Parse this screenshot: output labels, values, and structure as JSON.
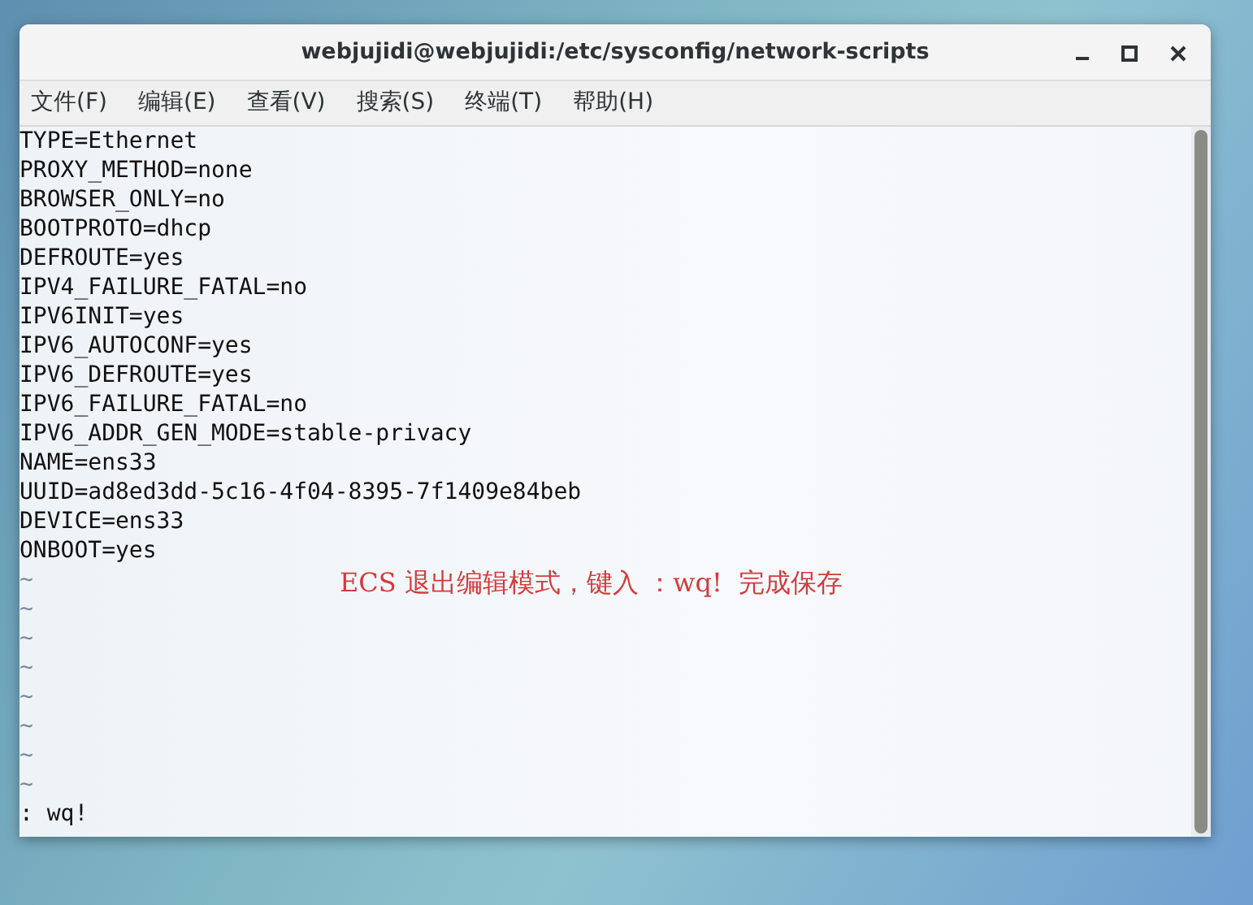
{
  "window": {
    "title": "webjujidi@webjujidi:/etc/sysconfig/network-scripts"
  },
  "menu": [
    "文件(F)",
    "编辑(E)",
    "查看(V)",
    "搜索(S)",
    "终端(T)",
    "帮助(H)"
  ],
  "lines": [
    "TYPE=Ethernet",
    "PROXY_METHOD=none",
    "BROWSER_ONLY=no",
    "BOOTPROTO=dhcp",
    "DEFROUTE=yes",
    "IPV4_FAILURE_FATAL=no",
    "IPV6INIT=yes",
    "IPV6_AUTOCONF=yes",
    "IPV6_DEFROUTE=yes",
    "IPV6_FAILURE_FATAL=no",
    "IPV6_ADDR_GEN_MODE=stable-privacy",
    "NAME=ens33",
    "UUID=ad8ed3dd-5c16-4f04-8395-7f1409e84beb",
    "DEVICE=ens33",
    "ONBOOT=yes"
  ],
  "empty_lines": [
    "~",
    "~",
    "~",
    "~",
    "~",
    "~",
    "~",
    "~"
  ],
  "command_line": ": wq!",
  "annotation": "ECS 退出编辑模式，键入 ：wq!  完成保存"
}
